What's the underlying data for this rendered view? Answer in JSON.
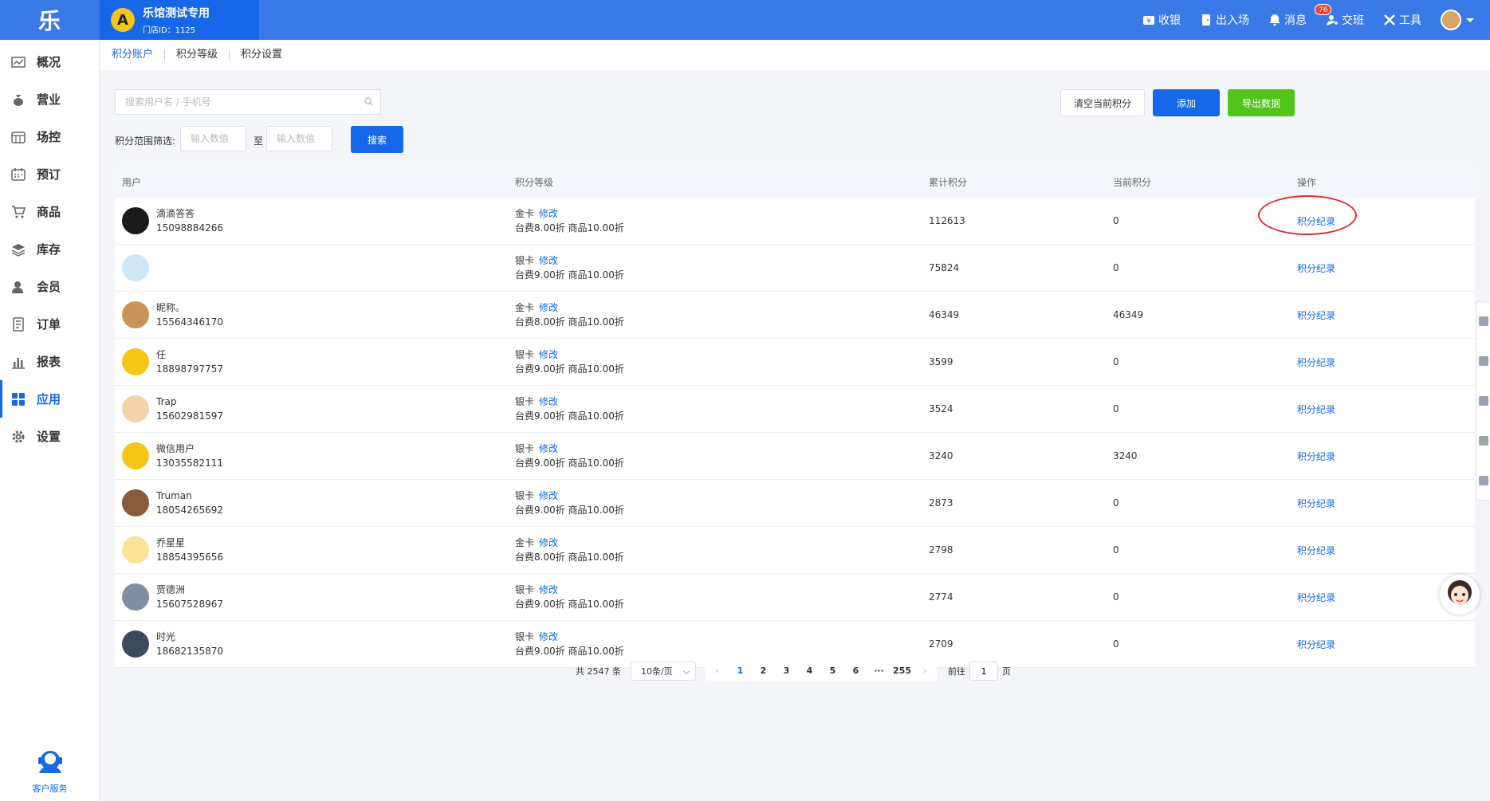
{
  "app": {
    "logo": "乐"
  },
  "store": {
    "name": "乐馆测试专用",
    "id_text": "门店ID：1125",
    "avatar_letter": "A"
  },
  "topbar": {
    "actions": [
      {
        "label": "收银",
        "icon": "cashier-icon"
      },
      {
        "label": "出入场",
        "icon": "door-icon"
      },
      {
        "label": "消息",
        "icon": "bell-icon",
        "badge": "76"
      },
      {
        "label": "交班",
        "icon": "handover-icon"
      },
      {
        "label": "工具",
        "icon": "tools-icon"
      }
    ]
  },
  "sidebar": {
    "items": [
      {
        "label": "概况",
        "icon": "chart-line-icon"
      },
      {
        "label": "营业",
        "icon": "money-bag-icon"
      },
      {
        "label": "场控",
        "icon": "calendar-grid-icon"
      },
      {
        "label": "预订",
        "icon": "calendar-icon"
      },
      {
        "label": "商品",
        "icon": "cart-icon"
      },
      {
        "label": "库存",
        "icon": "layers-icon"
      },
      {
        "label": "会员",
        "icon": "user-icon"
      },
      {
        "label": "订单",
        "icon": "order-icon"
      },
      {
        "label": "报表",
        "icon": "bar-chart-icon"
      },
      {
        "label": "应用",
        "icon": "apps-icon",
        "active": true
      },
      {
        "label": "设置",
        "icon": "gear-icon"
      }
    ],
    "service_label": "客户服务"
  },
  "tabs": [
    {
      "label": "积分账户",
      "active": true
    },
    {
      "label": "积分等级"
    },
    {
      "label": "积分设置"
    }
  ],
  "filters": {
    "search_placeholder": "搜索用户名 / 手机号",
    "range_label": "积分范围筛选:",
    "range_min_placeholder": "输入数值",
    "range_to": "至",
    "range_max_placeholder": "输入数值",
    "search_button": "搜索"
  },
  "actions": {
    "clear_label": "清空当前积分",
    "add_label": "添加",
    "export_label": "导出数据"
  },
  "table": {
    "headers": {
      "user": "用户",
      "level": "积分等级",
      "total": "累计积分",
      "current": "当前积分",
      "op": "操作"
    },
    "rows": [
      {
        "name": "滴滴答答",
        "phone": "15098884266",
        "level": "金卡",
        "edit": "修改",
        "discount": "台费8.00折 商品10.00折",
        "total": "112613",
        "current": "0",
        "op": "积分纪录",
        "avatar_color": "#1b1b1b"
      },
      {
        "name": "",
        "phone": "",
        "level": "银卡",
        "edit": "修改",
        "discount": "台费9.00折 商品10.00折",
        "total": "75824",
        "current": "0",
        "op": "积分纪录",
        "avatar_color": "#cfe6f7"
      },
      {
        "name": "昵称。",
        "phone": "15564346170",
        "level": "金卡",
        "edit": "修改",
        "discount": "台费8.00折 商品10.00折",
        "total": "46349",
        "current": "46349",
        "op": "积分纪录",
        "avatar_color": "#c9935a"
      },
      {
        "name": "任",
        "phone": "18898797757",
        "level": "银卡",
        "edit": "修改",
        "discount": "台费9.00折 商品10.00折",
        "total": "3599",
        "current": "0",
        "op": "积分纪录",
        "avatar_color": "#f5c518"
      },
      {
        "name": "Trap",
        "phone": "15602981597",
        "level": "银卡",
        "edit": "修改",
        "discount": "台费9.00折 商品10.00折",
        "total": "3524",
        "current": "0",
        "op": "积分纪录",
        "avatar_color": "#f3d4a8"
      },
      {
        "name": "微信用户",
        "phone": "13035582111",
        "level": "银卡",
        "edit": "修改",
        "discount": "台费9.00折 商品10.00折",
        "total": "3240",
        "current": "3240",
        "op": "积分纪录",
        "avatar_color": "#f5c518"
      },
      {
        "name": "Truman",
        "phone": "18054265692",
        "level": "银卡",
        "edit": "修改",
        "discount": "台费9.00折 商品10.00折",
        "total": "2873",
        "current": "0",
        "op": "积分纪录",
        "avatar_color": "#8a5a3c"
      },
      {
        "name": "乔星星",
        "phone": "18854395656",
        "level": "金卡",
        "edit": "修改",
        "discount": "台费8.00折 商品10.00折",
        "total": "2798",
        "current": "0",
        "op": "积分纪录",
        "avatar_color": "#fbe39a"
      },
      {
        "name": "贾德洲",
        "phone": "15607528967",
        "level": "银卡",
        "edit": "修改",
        "discount": "台费9.00折 商品10.00折",
        "total": "2774",
        "current": "0",
        "op": "积分纪录",
        "avatar_color": "#7f8ea3"
      },
      {
        "name": "时光",
        "phone": "18682135870",
        "level": "银卡",
        "edit": "修改",
        "discount": "台费9.00折 商品10.00折",
        "total": "2709",
        "current": "0",
        "op": "积分纪录",
        "avatar_color": "#3b4a5c"
      }
    ]
  },
  "pagination": {
    "total_text": "共 2547 条",
    "page_size": "10条/页",
    "prev": "‹",
    "pages": [
      "1",
      "2",
      "3",
      "4",
      "5",
      "6",
      "···",
      "255"
    ],
    "current": "1",
    "next": "›",
    "goto_label": "前往",
    "goto_value": "1",
    "goto_suffix": "页"
  },
  "colors": {
    "primary": "#1668e8",
    "topbar": "#3a7ae8",
    "success": "#52c41a",
    "highlight": "#e23030"
  }
}
